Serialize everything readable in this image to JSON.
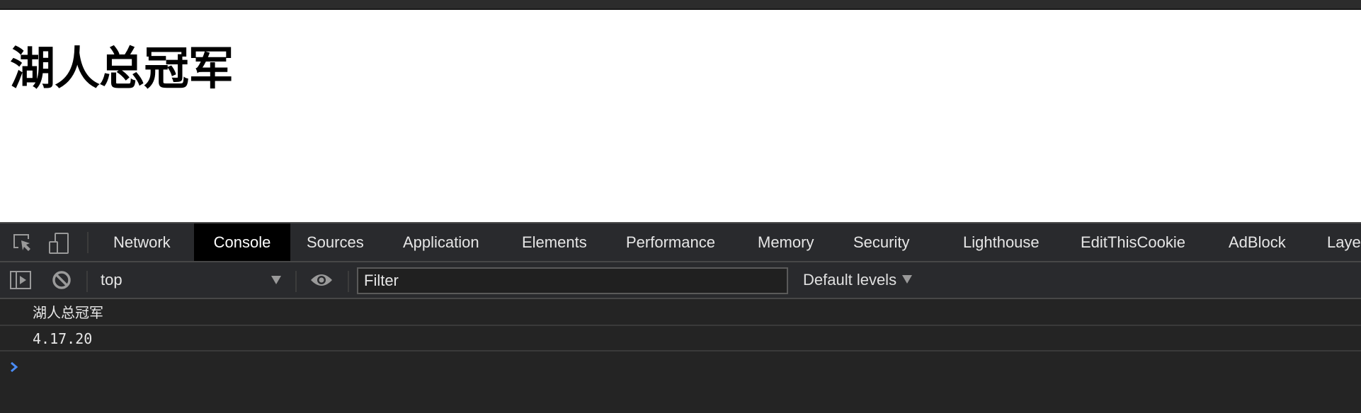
{
  "page": {
    "heading": "湖人总冠军"
  },
  "devtools": {
    "tabs": [
      {
        "label": "Network",
        "active": false
      },
      {
        "label": "Console",
        "active": true
      },
      {
        "label": "Sources",
        "active": false
      },
      {
        "label": "Application",
        "active": false
      },
      {
        "label": "Elements",
        "active": false
      },
      {
        "label": "Performance",
        "active": false
      },
      {
        "label": "Memory",
        "active": false
      },
      {
        "label": "Security",
        "active": false
      },
      {
        "label": "Lighthouse",
        "active": false
      },
      {
        "label": "EditThisCookie",
        "active": false
      },
      {
        "label": "AdBlock",
        "active": false
      },
      {
        "label": "Laye",
        "active": false
      }
    ],
    "toolbar_icons": {
      "inspect": "inspect-element-icon",
      "device": "device-toolbar-icon",
      "sidebar": "show-sidebar-icon",
      "clear": "clear-console-icon",
      "live_expression": "eye-icon"
    },
    "context": {
      "selected": "top"
    },
    "filter": {
      "placeholder": "Filter",
      "value": ""
    },
    "levels": {
      "label": "Default levels"
    },
    "console": {
      "messages": [
        {
          "text": "湖人总冠军"
        },
        {
          "text": "4.17.20"
        }
      ],
      "prompt_color": "#4a8cf7"
    }
  },
  "colors": {
    "panel_bg": "#292a2d",
    "console_bg": "#242424",
    "active_tab_bg": "#000000",
    "text": "#e6e6e6"
  }
}
